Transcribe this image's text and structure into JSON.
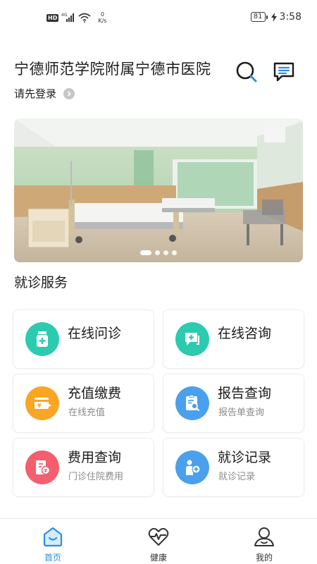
{
  "status_bar": {
    "hd": "HD",
    "network_type": "4G",
    "speed_value": "0",
    "speed_unit": "K/s",
    "battery": "81",
    "time": "3:58"
  },
  "header": {
    "hospital_name": "宁德师范学院附属宁德市医院",
    "login_prompt": "请先登录",
    "icons": [
      "search-icon",
      "message-icon"
    ]
  },
  "banner": {
    "slide_count": 4,
    "active_slide": 1
  },
  "services": {
    "title": "就诊服务",
    "items": [
      {
        "title": "在线问诊",
        "subtitle": "",
        "icon": "medicine-bottle-icon",
        "color": "#2ccbb0"
      },
      {
        "title": "在线咨询",
        "subtitle": "",
        "icon": "chat-plus-icon",
        "color": "#2ccbb0"
      },
      {
        "title": "充值缴费",
        "subtitle": "在线充值",
        "icon": "payment-card-icon",
        "color": "#f8a623"
      },
      {
        "title": "报告查询",
        "subtitle": "报告单查询",
        "icon": "report-search-icon",
        "color": "#4aa0ec"
      },
      {
        "title": "费用查询",
        "subtitle": "门诊住院费用",
        "icon": "fee-query-icon",
        "color": "#f35f6d"
      },
      {
        "title": "就诊记录",
        "subtitle": "就诊记录",
        "icon": "visit-record-icon",
        "color": "#4aa0ec"
      }
    ]
  },
  "bottom_nav": {
    "active_color": "#2d8fe0",
    "items": [
      {
        "label": "首页",
        "icon": "home-icon",
        "active": true
      },
      {
        "label": "健康",
        "icon": "heart-pulse-icon",
        "active": false
      },
      {
        "label": "我的",
        "icon": "user-icon",
        "active": false
      }
    ]
  }
}
